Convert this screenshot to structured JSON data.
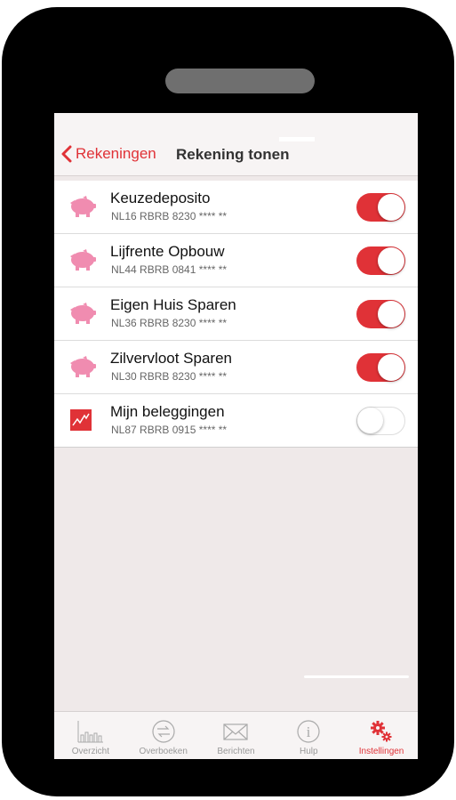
{
  "nav": {
    "back_label": "Rekeningen",
    "title": "Rekening tonen"
  },
  "accounts": [
    {
      "name": "Keuzedeposito",
      "iban": "NL16 RBRB 8230 **** **",
      "icon": "piggy-bank-icon",
      "enabled": true
    },
    {
      "name": "Lijfrente Opbouw",
      "iban": "NL44 RBRB 0841 **** **",
      "icon": "piggy-bank-icon",
      "enabled": true
    },
    {
      "name": "Eigen Huis Sparen",
      "iban": "NL36 RBRB 8230 **** **",
      "icon": "piggy-bank-icon",
      "enabled": true
    },
    {
      "name": "Zilvervloot Sparen",
      "iban": "NL30 RBRB 8230 **** **",
      "icon": "piggy-bank-icon",
      "enabled": true
    },
    {
      "name": "Mijn beleggingen",
      "iban": "NL87 RBRB 0915 **** **",
      "icon": "investment-chart-icon",
      "enabled": false
    }
  ],
  "tabs": [
    {
      "label": "Overzicht",
      "icon": "bar-chart-icon",
      "active": false
    },
    {
      "label": "Overboeken",
      "icon": "transfer-icon",
      "active": false
    },
    {
      "label": "Berichten",
      "icon": "envelope-icon",
      "active": false
    },
    {
      "label": "Hulp",
      "icon": "info-icon",
      "active": false
    },
    {
      "label": "Instellingen",
      "icon": "gears-icon",
      "active": true
    }
  ],
  "colors": {
    "accent": "#e03237",
    "piggy": "#f08cb0",
    "background": "#efe9e9"
  }
}
